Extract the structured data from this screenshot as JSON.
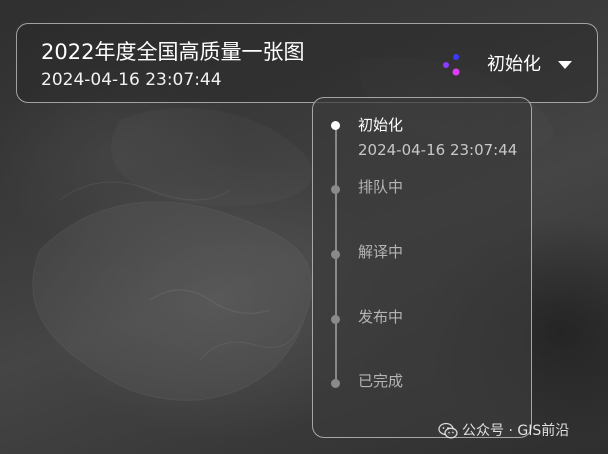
{
  "header": {
    "title": "2022年度全国高质量一张图",
    "timestamp": "2024-04-16 23:07:44",
    "status": {
      "label": "初始化",
      "icon": "spinner-dots-icon",
      "dropdown_icon": "caret-down-icon"
    }
  },
  "status_timeline": {
    "steps": [
      {
        "label": "初始化",
        "time": "2024-04-16 23:07:44",
        "active": true
      },
      {
        "label": "排队中",
        "time": "",
        "active": false
      },
      {
        "label": "解译中",
        "time": "",
        "active": false
      },
      {
        "label": "发布中",
        "time": "",
        "active": false
      },
      {
        "label": "已完成",
        "time": "",
        "active": false
      }
    ]
  },
  "watermark": {
    "text": "公众号 · GIS前沿",
    "icon": "wechat-icon"
  },
  "colors": {
    "spinner_blue": "#3b3bff",
    "spinner_purple": "#8a3cff",
    "spinner_magenta": "#e03cff",
    "active_dot": "#ffffff",
    "inactive_dot": "#8a8a8a"
  }
}
